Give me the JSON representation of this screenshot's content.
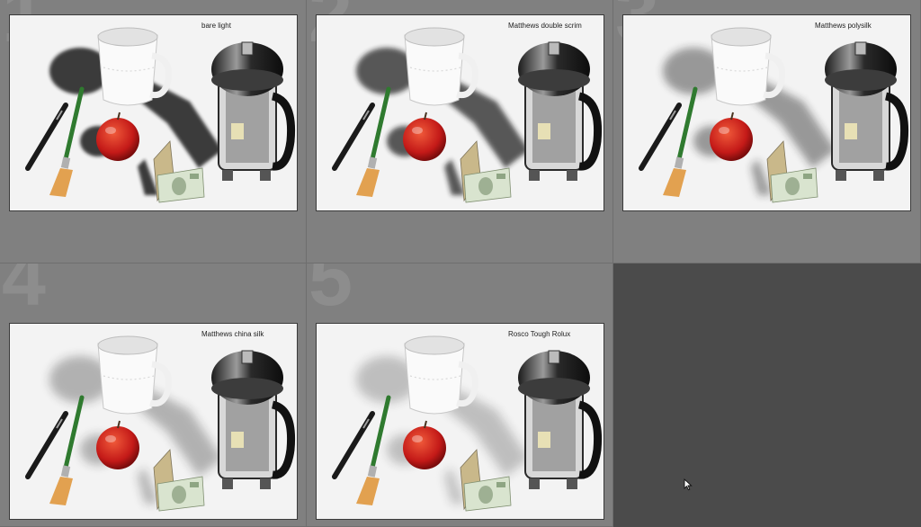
{
  "grid": {
    "cells": [
      {
        "index": "1",
        "label": "bare light",
        "shadow_opacity": 0.85
      },
      {
        "index": "2",
        "label": "Matthews double scrim",
        "shadow_opacity": 0.72
      },
      {
        "index": "3",
        "label": "Matthews polysilk",
        "shadow_opacity": 0.42
      },
      {
        "index": "4",
        "label": "Matthews china silk",
        "shadow_opacity": 0.3
      },
      {
        "index": "5",
        "label": "Rosco Tough Rolux",
        "shadow_opacity": 0.24
      }
    ]
  },
  "colors": {
    "cell_background": "#808080",
    "empty_background": "#4b4b4b",
    "photo_background": "#f3f3f3",
    "index_numeral": "#8d8d8d"
  },
  "icons": {
    "cursor": "mouse-pointer-icon"
  }
}
